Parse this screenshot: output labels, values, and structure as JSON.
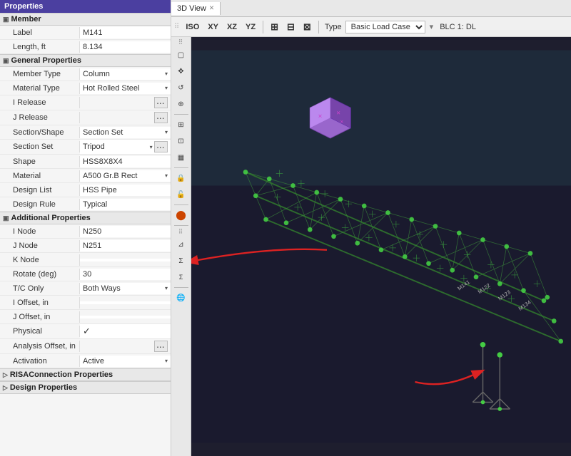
{
  "panel": {
    "title": "Properties",
    "sections": {
      "member": {
        "label": "Member",
        "fields": [
          {
            "label": "Label",
            "value": "M141"
          },
          {
            "label": "Length, ft",
            "value": "8.134"
          }
        ]
      },
      "general": {
        "label": "General Properties",
        "fields": [
          {
            "label": "Member Type",
            "value": "Column",
            "type": "dropdown"
          },
          {
            "label": "Material Type",
            "value": "Hot Rolled Steel",
            "type": "dropdown"
          },
          {
            "label": "I Release",
            "value": "",
            "type": "dots"
          },
          {
            "label": "J Release",
            "value": "",
            "type": "dots"
          },
          {
            "label": "Section/Shape",
            "value": "Section Set",
            "type": "dropdown"
          },
          {
            "label": "Section Set",
            "value": "Tripod",
            "type": "dropdown-dots"
          },
          {
            "label": "Shape",
            "value": "HSS8X8X4"
          },
          {
            "label": "Material",
            "value": "A500 Gr.B Rect",
            "type": "dropdown"
          },
          {
            "label": "Design List",
            "value": "HSS Pipe"
          },
          {
            "label": "Design Rule",
            "value": "Typical"
          }
        ]
      },
      "additional": {
        "label": "Additional Properties",
        "fields": [
          {
            "label": "I Node",
            "value": "N250"
          },
          {
            "label": "J Node",
            "value": "N251"
          },
          {
            "label": "K Node",
            "value": ""
          },
          {
            "label": "Rotate (deg)",
            "value": "30"
          },
          {
            "label": "T/C Only",
            "value": "Both Ways",
            "type": "dropdown"
          },
          {
            "label": "I Offset, in",
            "value": ""
          },
          {
            "label": "J Offset, in",
            "value": ""
          },
          {
            "label": "Physical",
            "value": "check",
            "type": "check"
          },
          {
            "label": "Analysis Offset, in",
            "value": "",
            "type": "dots"
          },
          {
            "label": "Activation",
            "value": "Active",
            "type": "dropdown"
          }
        ]
      },
      "risa": {
        "label": "RISAConnection Properties"
      },
      "design": {
        "label": "Design Properties"
      }
    }
  },
  "view": {
    "tab_label": "3D View",
    "toolbar": {
      "buttons": [
        "ISO",
        "XY",
        "XZ",
        "YZ"
      ],
      "type_label": "Type",
      "type_value": "Basic Load Case",
      "blc_label": "BLC 1: DL"
    }
  },
  "icons": {
    "toggle_closed": "▣",
    "dropdown": "▾",
    "dots": "...",
    "checkmark": "✓",
    "close": "✕"
  }
}
